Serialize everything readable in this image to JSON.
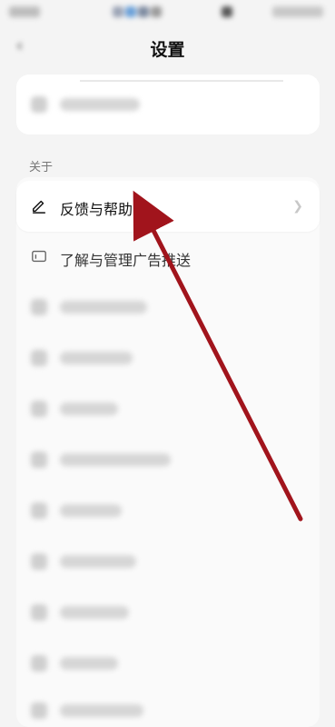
{
  "header": {
    "title": "设置"
  },
  "sections": {
    "about_label": "关于"
  },
  "about": {
    "feedback_label": "反馈与帮助",
    "ads_label": "了解与管理广告推送"
  },
  "colors": {
    "arrow": "#a1141c",
    "background": "#f4f4f4",
    "card": "#ffffff"
  },
  "icons": {
    "feedback": "pencil-icon",
    "ads": "ad-icon",
    "back": "back-arrow-icon",
    "chevron": "chevron-right-icon"
  }
}
